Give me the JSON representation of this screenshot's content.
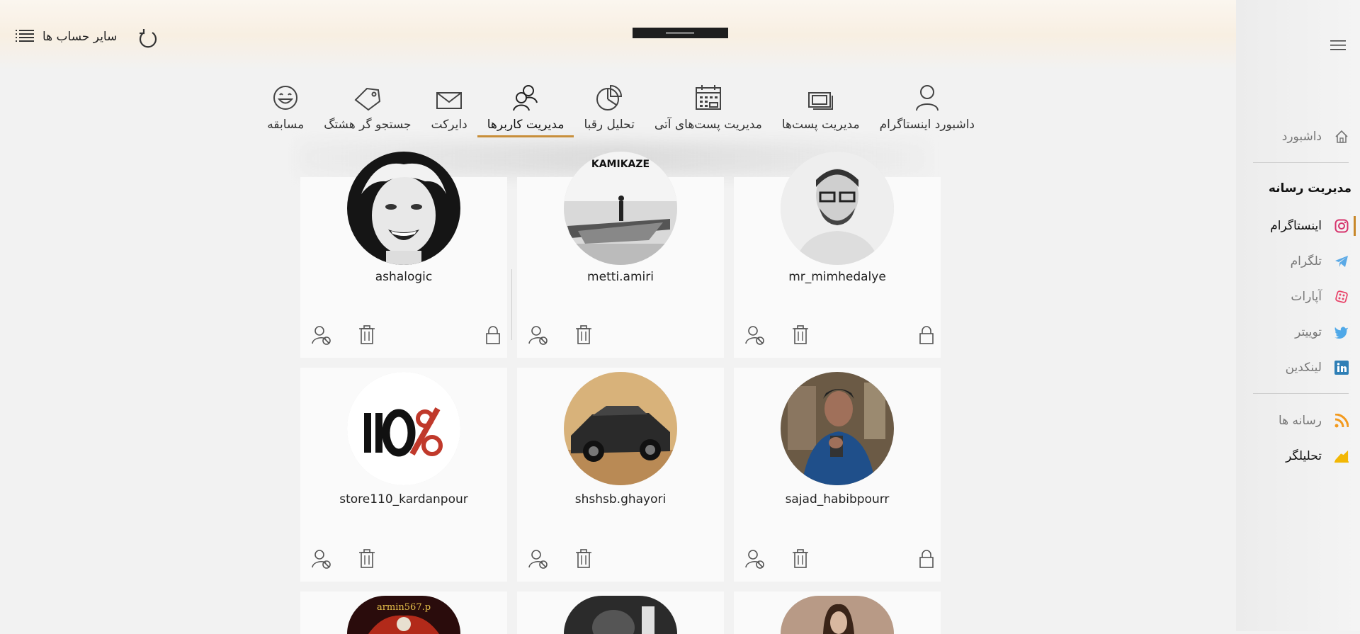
{
  "header": {
    "account_switch_label": "سایر حساب ها"
  },
  "tabs": [
    {
      "label": "داشبورد اینستاگرام",
      "icon": "user-icon",
      "active": false
    },
    {
      "label": "مدیریت پست‌ها",
      "icon": "posts-icon",
      "active": false
    },
    {
      "label": "مدیریت پست‌های آتی",
      "icon": "calendar-icon",
      "active": false
    },
    {
      "label": "تحلیل رقبا",
      "icon": "pie-chart-icon",
      "active": false
    },
    {
      "label": "مدیریت کاربرها",
      "icon": "users-icon",
      "active": true
    },
    {
      "label": "دایرکت",
      "icon": "mail-icon",
      "active": false
    },
    {
      "label": "جستجو گر هشتگ",
      "icon": "tag-icon",
      "active": false
    },
    {
      "label": "مسابقه",
      "icon": "smile-icon",
      "active": false
    }
  ],
  "users": [
    {
      "username": "mr_mimhedalye",
      "has_lock": true
    },
    {
      "username": "metti.amiri",
      "has_lock": false
    },
    {
      "username": "ashalogic",
      "has_lock": true
    },
    {
      "username": "sajad_habibpourr",
      "has_lock": true
    },
    {
      "username": "shshsb.ghayori",
      "has_lock": false
    },
    {
      "username": "store110_kardanpour",
      "has_lock": false
    }
  ],
  "partial_avatar_text": "armin567.p",
  "metti_avatar_text": "KAMIKAZE",
  "store_logo_text": "110%",
  "sidebar": {
    "dashboard": "داشبورد",
    "media_management_heading": "مدیریت رسانه",
    "instagram": "اینستاگرام",
    "telegram": "تلگرام",
    "aparat": "آپارات",
    "twitter": "توییتر",
    "linkedin": "لینکدین",
    "feeds": "رسانه ها",
    "analyzer": "تحلیلگر"
  },
  "colors": {
    "accent": "#c8882a",
    "instagram": "#d6336c",
    "telegram": "#5aa9e6",
    "aparat": "#e8456b",
    "twitter": "#4fa8e8",
    "linkedin": "#2f7fb6",
    "rss": "#f39a1e",
    "analyzer": "#f2b705"
  }
}
